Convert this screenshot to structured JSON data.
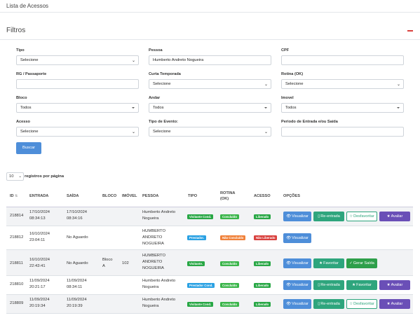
{
  "page": {
    "title": "Lista de Acessos"
  },
  "filters": {
    "title": "Filtros",
    "tipo": {
      "label": "Tipo",
      "value": "Selecione"
    },
    "pessoa": {
      "label": "Pessoa",
      "value": "Humberto Andreto Nogueira"
    },
    "cpf": {
      "label": "CPF",
      "value": ""
    },
    "rg": {
      "label": "RG / Passaporte",
      "value": ""
    },
    "curta": {
      "label": "Curta Temporada",
      "value": "Selecione"
    },
    "rotina": {
      "label": "Rotina (OK)",
      "value": "Selecione"
    },
    "bloco": {
      "label": "Bloco",
      "value": "Todos"
    },
    "andar": {
      "label": "Andar",
      "value": "Todos"
    },
    "imovel": {
      "label": "Imovel",
      "value": "Todos"
    },
    "acesso": {
      "label": "Acesso",
      "value": "Selecione"
    },
    "tipo_evento": {
      "label": "Tipo de Evento:",
      "value": "Selecione"
    },
    "periodo": {
      "label": "Periodo de Entrada e/ou Saída",
      "value": ""
    },
    "buscar_label": "Buscar"
  },
  "pagination": {
    "page_size": "10",
    "label": "registros por página"
  },
  "table": {
    "headers": {
      "id": "ID",
      "entrada": "ENTRADA",
      "saida": "SAÍDA",
      "bloco": "BLOCO",
      "imovel": "IMÓVEL",
      "pessoa": "PESSOA",
      "tipo": "TIPO",
      "rotina": "ROTINA (OK)",
      "acesso": "ACESSO",
      "opcoes": "OPÇÕES"
    },
    "rows": [
      {
        "id": "218814",
        "entrada": "17/10/2024 08:34:13",
        "saida": "17/10/2024 08:34:16",
        "bloco": "",
        "imovel": "",
        "pessoa": "Humberto Andreto Nogueira",
        "tipo": "Visitante Cond.",
        "rotina": "Concluído",
        "acesso": "Liberado"
      },
      {
        "id": "218812",
        "entrada": "16/10/2024 23:04:11",
        "saida": "No Aguardo",
        "bloco": "",
        "imovel": "",
        "pessoa": "HUMBERTO ANDRETO NOGUEIRA",
        "tipo": "Prestador.",
        "rotina": "Não Concluído",
        "acesso": "Não Liberado"
      },
      {
        "id": "218811",
        "entrada": "16/10/2024 22:43:41",
        "saida": "No Aguardo",
        "bloco": "Bloco A",
        "imovel": "102",
        "pessoa": "HUMBERTO ANDRETO NOGUEIRA",
        "tipo": "Visitante.",
        "rotina": "Concluído",
        "acesso": "Liberado"
      },
      {
        "id": "218810",
        "entrada": "11/09/2024 20:21:17",
        "saida": "11/09/2024 08:34:11",
        "bloco": "",
        "imovel": "",
        "pessoa": "Humberto Andreto Nogueira",
        "tipo": "Prestador Cond.",
        "rotina": "Concluído",
        "acesso": "Liberado"
      },
      {
        "id": "218809",
        "entrada": "11/09/2024 20:19:34",
        "saida": "11/09/2024 20:19:39",
        "bloco": "",
        "imovel": "",
        "pessoa": "Humberto Andreto Nogueira",
        "tipo": "Visitante Cond.",
        "rotina": "Concluído",
        "acesso": "Liberado"
      }
    ]
  },
  "actions": {
    "visualizar": "Visualizar",
    "reentrada": "Re-entrada",
    "desfavoritar": "Desfavoritar",
    "avaliar": "Avaliar",
    "favoritar": "Favoritar",
    "gerar_saida": "Gerar Saída"
  },
  "colors": {
    "primary": "#4e8ed9",
    "teal": "#2ea57d",
    "purple": "#6a4fb7",
    "danger": "#d9413e"
  }
}
